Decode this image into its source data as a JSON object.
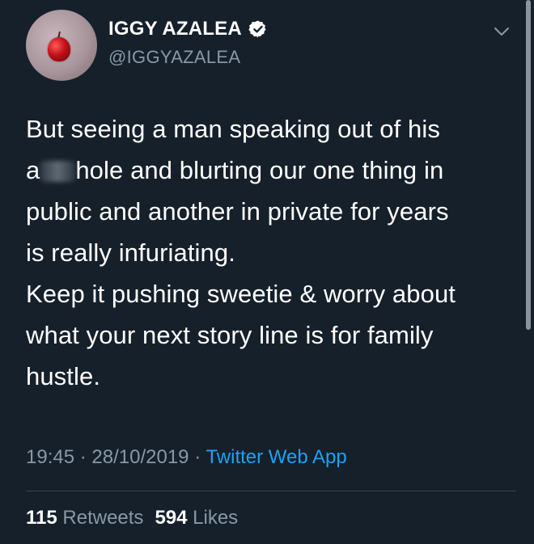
{
  "colors": {
    "background": "#15202b",
    "text": "#ffffff",
    "secondary_text": "#8899a6",
    "link": "#1da1f2",
    "divider": "#38444d",
    "verified_badge": "#ffffff"
  },
  "author": {
    "avatar_icon": "cherry-avatar",
    "name": "IGGY AZALEA",
    "verified_icon": "verified-badge-icon",
    "handle": "@IGGYAZALEA"
  },
  "menu_icon": "chevron-down-icon",
  "tweet": {
    "lines": [
      "But seeing a man speaking out of his",
      "hole and blurting our one thing in",
      "public and another in private for years",
      "is really infuriating.",
      "Keep it pushing sweetie & worry about",
      "what your next story line is for family",
      "hustle."
    ],
    "line2_prefix": "a"
  },
  "meta": {
    "time": "19:45",
    "separator": "·",
    "date": "28/10/2019",
    "source": "Twitter Web App"
  },
  "stats": {
    "retweets_count": "115",
    "retweets_label": "Retweets",
    "likes_count": "594",
    "likes_label": "Likes"
  }
}
